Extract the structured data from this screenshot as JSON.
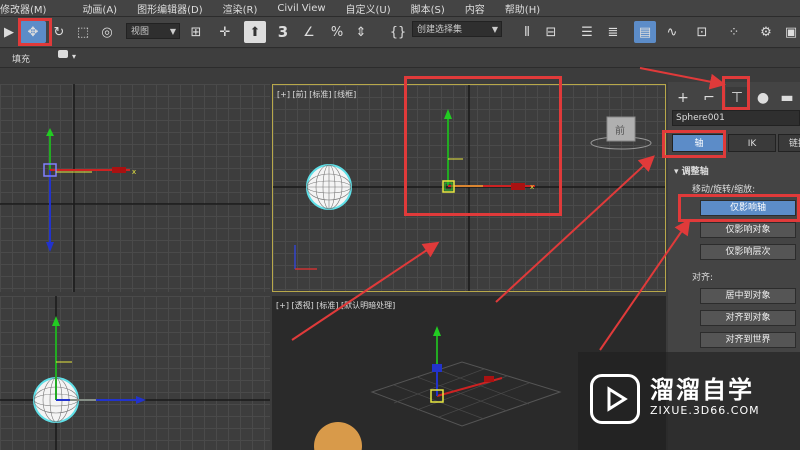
{
  "menubar": {
    "items": [
      "修改器(M)",
      "动画(A)",
      "图形编辑器(D)",
      "渲染(R)",
      "Civil View",
      "自定义(U)",
      "脚本(S)",
      "内容",
      "帮助(H)"
    ]
  },
  "toolbar": {
    "view_combo": "视图",
    "selection_set_combo": "创建选择集",
    "snap_label": "3"
  },
  "ribbon": {
    "fill_label": "填充"
  },
  "viewports": {
    "front": {
      "label": "[+] [前] [标准] [线框]"
    },
    "perspective": {
      "label": "[+] [透视] [标准] [默认明暗处理]"
    },
    "viewcube_face": "前"
  },
  "command_panel": {
    "object_name": "Sphere001",
    "tabs": [
      "轴",
      "IK",
      "链接"
    ],
    "rollout_title": "调整轴",
    "move_rotate_scale_label": "移动/旋转/缩放:",
    "buttons_affect": [
      "仅影响轴",
      "仅影响对象",
      "仅影响层次"
    ],
    "align_label": "对齐:",
    "buttons_align": [
      "居中到对象",
      "对齐到对象",
      "对齐到世界"
    ]
  },
  "watermark": {
    "title": "溜溜自学",
    "url": "ZIXUE.3D66.COM"
  },
  "colors": {
    "highlight_red": "#e03a3a",
    "active_blue": "#5c8cc8",
    "sphere_wire": "#5fe0e8"
  }
}
